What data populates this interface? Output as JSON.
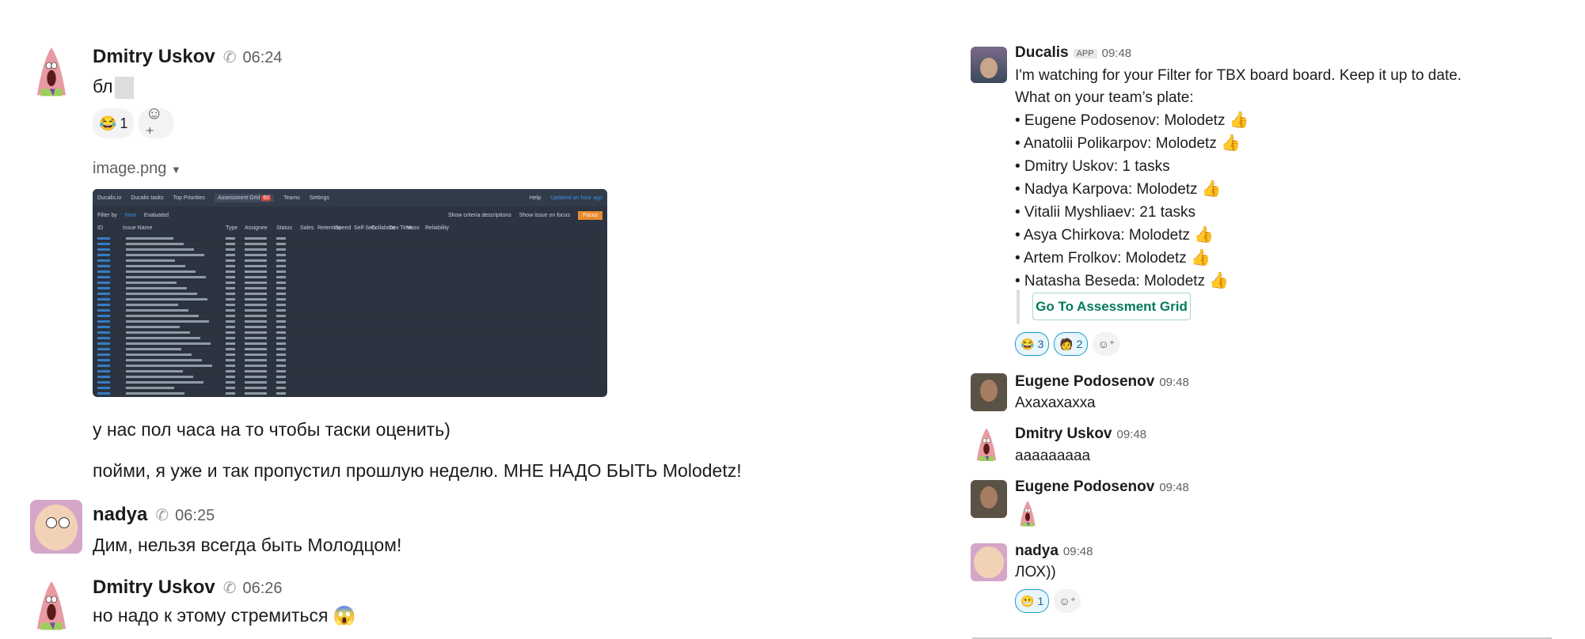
{
  "left": {
    "m1": {
      "author": "Dmitry Uskov",
      "time": "06:24",
      "text": "бл",
      "reaction": {
        "emoji": "😂",
        "count": "1"
      },
      "file": {
        "name": "image.png"
      }
    },
    "thumb": {
      "tabs": [
        "Ducalis.io",
        "Ducalis tasks",
        "Top Priorities",
        "Assessment Grid",
        "Teams",
        "Settings"
      ],
      "badge": "60",
      "help": "Help",
      "updated": "Updated an hour ago",
      "filter_by": "Filter by",
      "filters": [
        "New",
        "Evaluated"
      ],
      "toggles": [
        "Show criteria descriptions",
        "Show issue on focus"
      ],
      "focus": "Focus",
      "columns": [
        "ID",
        "Issue Name",
        "Type",
        "Assignee",
        "Status",
        "Sales",
        "Retention",
        "Speed",
        "Self-Serv",
        "Collabora",
        "Dev Time",
        "Mass",
        "Reliability"
      ]
    },
    "m2": {
      "text": "у нас пол часа на то чтобы таски оценить)"
    },
    "m3": {
      "text": "пойми, я уже и так пропустил прошлую неделю. МНЕ НАДО БЫТЬ Molodetz!"
    },
    "m4": {
      "author": "nadya",
      "time": "06:25",
      "text": "Дим, нельзя всегда быть Молодцом!"
    },
    "m5": {
      "author": "Dmitry Uskov",
      "time": "06:26",
      "text": "но надо к этому стремиться",
      "emoji": "😱"
    }
  },
  "right": {
    "bot": {
      "author": "Ducalis",
      "badge": "APP",
      "time": "09:48",
      "line1": "I'm watching for your Filter for TBX board board. Keep it up to date.",
      "line2": "What on your team’s plate:",
      "items": [
        {
          "text": "• Eugene Podosenov: Molodetz",
          "emoji": "👍"
        },
        {
          "text": "• Anatolii Polikarpov: Molodetz",
          "emoji": "👍"
        },
        {
          "text": "• Dmitry Uskov: 1 tasks",
          "emoji": ""
        },
        {
          "text": "• Nadya Karpova: Molodetz",
          "emoji": "👍"
        },
        {
          "text": "• Vitalii Myshliaev: 21 tasks",
          "emoji": ""
        },
        {
          "text": "• Asya Chirkova: Molodetz",
          "emoji": "👍"
        },
        {
          "text": "• Artem Frolkov: Molodetz",
          "emoji": "👍"
        },
        {
          "text": "• Natasha Beseda: Molodetz",
          "emoji": "👍"
        }
      ],
      "button": "Go To Assessment Grid",
      "reactions": [
        {
          "emoji": "😂",
          "count": "3"
        },
        {
          "emoji": "🧑",
          "count": "2"
        }
      ]
    },
    "m1": {
      "author": "Eugene Podosenov",
      "time": "09:48",
      "text": "Ахахахахха"
    },
    "m2": {
      "author": "Dmitry Uskov",
      "time": "09:48",
      "text": "aaaaaaaaa"
    },
    "m3": {
      "author": "Eugene Podosenov",
      "time": "09:48"
    },
    "m4": {
      "author": "nadya",
      "time": "09:48",
      "text": "ЛОХ))",
      "reaction": {
        "emoji": "😬",
        "count": "1"
      }
    }
  }
}
